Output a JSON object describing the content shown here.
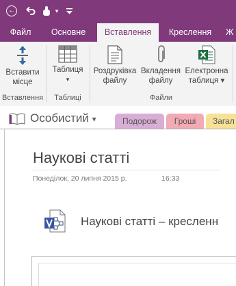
{
  "window": {
    "quick_access": [
      {
        "name": "back-icon"
      },
      {
        "name": "undo-icon"
      },
      {
        "name": "touch-mode-icon"
      },
      {
        "name": "customize-toolbar-icon"
      }
    ]
  },
  "ribbon_tabs": [
    {
      "label": "Файл",
      "active": false
    },
    {
      "label": "Основне",
      "active": false
    },
    {
      "label": "Вставлення",
      "active": true
    },
    {
      "label": "Креслення",
      "active": false
    },
    {
      "label": "Ж",
      "active": false
    }
  ],
  "ribbon": {
    "groups": {
      "insert": "Вставлення",
      "tables": "Таблиці",
      "files": "Файли"
    },
    "buttons": {
      "insert_space": [
        "Вставити",
        "місце"
      ],
      "table": [
        "Таблиця",
        "▾"
      ],
      "file_printout": [
        "Роздруківка",
        "файлу"
      ],
      "file_attachment": [
        "Вкладення",
        "файлу"
      ],
      "spreadsheet": [
        "Електронна",
        "таблиця ▾"
      ]
    }
  },
  "notebook": {
    "name": "Особистий",
    "sections": [
      "Подорож",
      "Гроші",
      "Загал"
    ]
  },
  "page": {
    "title": "Наукові статті",
    "date": "Понеділок, 20 липня 2015 р.",
    "time": "16:33",
    "attachment_name": "Наукові статті – кресленн"
  },
  "colors": {
    "accent": "#80397b",
    "tab_purple": "#d9aed6",
    "tab_pink": "#f2aab4",
    "tab_yellow": "#f7e199"
  }
}
